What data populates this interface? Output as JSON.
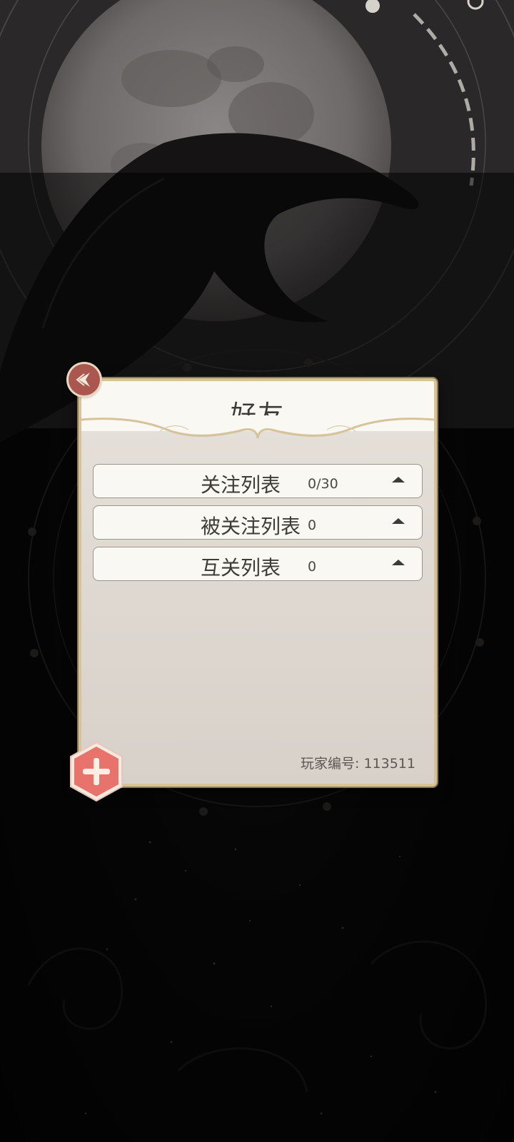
{
  "dialog": {
    "title": "好友",
    "rows": [
      {
        "label": "关注列表",
        "count": "0/30"
      },
      {
        "label": "被关注列表",
        "count": "0"
      },
      {
        "label": "互关列表",
        "count": "0"
      }
    ],
    "player_id_label": "玩家编号: 113511"
  },
  "icons": {
    "badge": "back-arrow-icon",
    "add": "plus-icon",
    "row_toggle": "caret-up-icon"
  },
  "colors": {
    "panel_border": "#d6c39a",
    "panel_body": "#ddd7d0",
    "accent_red": "#e8736c",
    "badge": "#a9574f"
  }
}
